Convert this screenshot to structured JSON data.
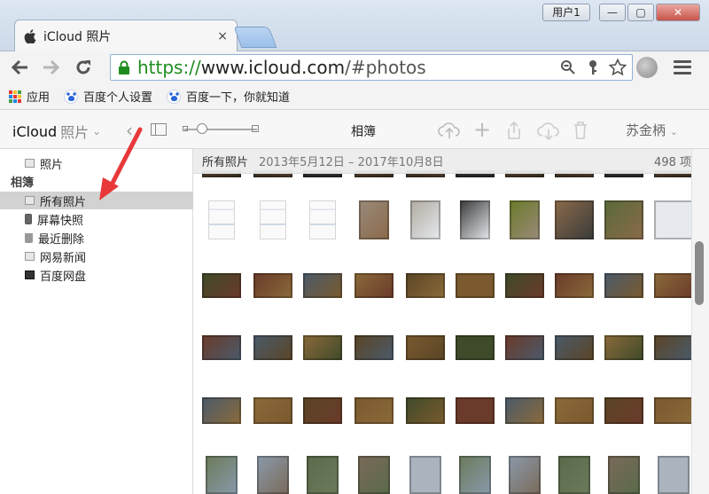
{
  "window": {
    "tab_title": "iCloud 照片",
    "tab_close": "×",
    "user_label": "用户1",
    "min_glyph": "—",
    "max_glyph": "▢",
    "close_glyph": "✕"
  },
  "address_bar": {
    "url_scheme": "https://",
    "url_host": "www.icloud.com",
    "url_path": "/#photos"
  },
  "bookmarks": [
    {
      "label": "应用"
    },
    {
      "label": "百度个人设置"
    },
    {
      "label": "百度一下，你就知道"
    }
  ],
  "app_toolbar": {
    "app_name": "iCloud",
    "app_sub": "照片",
    "view_title": "相簿",
    "account_name": "苏金柄"
  },
  "sidebar": {
    "top_item": "照片",
    "section_heading": "相簿",
    "albums": [
      {
        "label": "所有照片",
        "selected": true
      },
      {
        "label": "屏幕快照",
        "selected": false
      },
      {
        "label": "最近删除",
        "selected": false
      },
      {
        "label": "网易新闻",
        "selected": false
      },
      {
        "label": "百度网盘",
        "selected": false
      }
    ]
  },
  "main": {
    "header_title": "所有照片",
    "date_range": "2013年5月12日 – 2017年10月8日",
    "photo_count": "498 项"
  },
  "colors": {
    "url_secure": "#1e8c1e",
    "selected_row": "#d2d2d2",
    "arrow": "#e8383a"
  }
}
